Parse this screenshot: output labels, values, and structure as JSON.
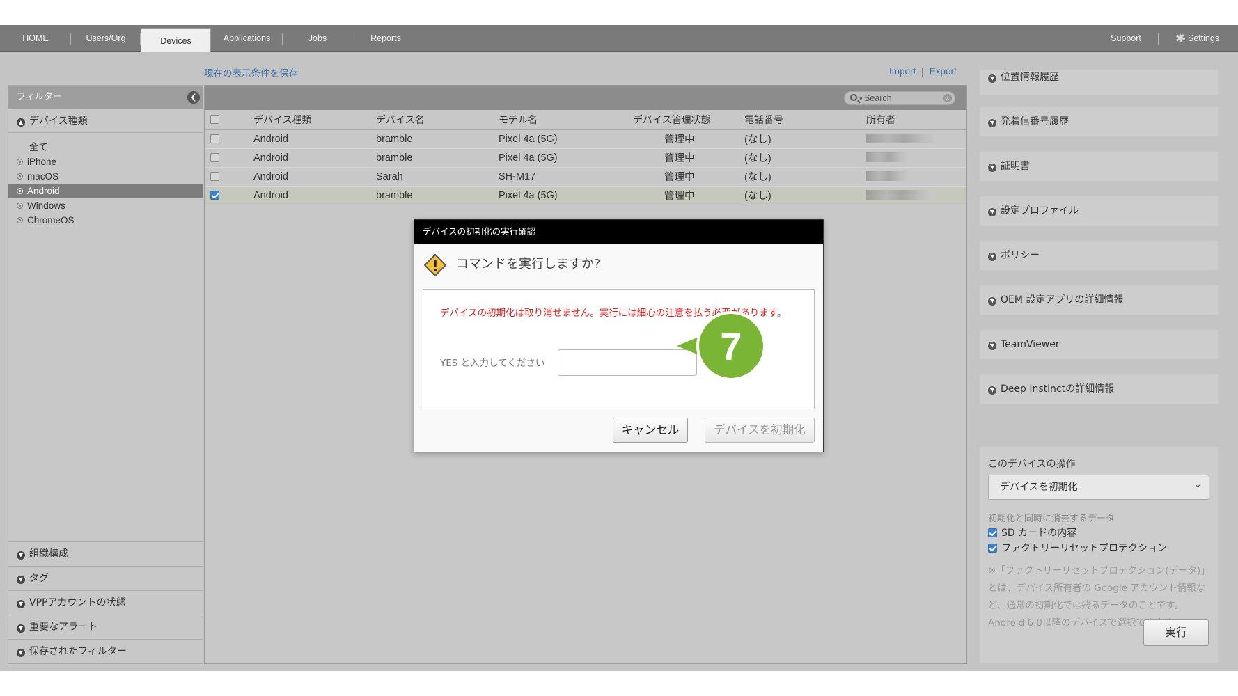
{
  "nav": {
    "home": "HOME",
    "users": "Users/Org",
    "devices": "Devices",
    "applications": "Applications",
    "jobs": "Jobs",
    "reports": "Reports",
    "support": "Support",
    "settings": "Settings"
  },
  "links": {
    "save_view": "現在の表示条件を保存",
    "import": "Import",
    "separator": "|",
    "export": "Export"
  },
  "sidebar": {
    "filter_title": "フィルター",
    "device_types_title": "デバイス種類",
    "types": [
      "全て",
      "iPhone",
      "macOS",
      "Android",
      "Windows",
      "ChromeOS"
    ],
    "selected_type": "Android",
    "sections": [
      "組織構成",
      "タグ",
      "VPPアカウントの状態",
      "重要なアラート",
      "保存されたフィルター"
    ]
  },
  "search": {
    "placeholder": "Search"
  },
  "table": {
    "headers": [
      "デバイス種類",
      "デバイス名",
      "モデル名",
      "デバイス管理状態",
      "電話番号",
      "所有者"
    ],
    "rows": [
      {
        "type": "Android",
        "name": "bramble",
        "model": "Pixel 4a (5G)",
        "status": "管理中",
        "phone": "(なし)",
        "checked": false
      },
      {
        "type": "Android",
        "name": "bramble",
        "model": "Pixel 4a (5G)",
        "status": "管理中",
        "phone": "(なし)",
        "checked": false
      },
      {
        "type": "Android",
        "name": "Sarah",
        "model": "SH-M17",
        "status": "管理中",
        "phone": "(なし)",
        "checked": false
      },
      {
        "type": "Android",
        "name": "bramble",
        "model": "Pixel 4a (5G)",
        "status": "管理中",
        "phone": "(なし)",
        "checked": true
      }
    ]
  },
  "modal": {
    "title": "デバイスの初期化の実行確認",
    "question": "コマンドを実行しますか?",
    "warning": "デバイスの初期化は取り消せません。実行には細心の注意を払う必要があります。",
    "input_label": "YES と入力してください",
    "input_value": "",
    "cancel": "キャンセル",
    "confirm": "デバイスを初期化"
  },
  "callout": {
    "number": "7",
    "color": "#7ab536"
  },
  "right_panel": {
    "items": [
      "位置情報履歴",
      "発着信番号履歴",
      "証明書",
      "設定プロファイル",
      "ポリシー",
      "OEM 設定アプリの詳細情報",
      "TeamViewer",
      "Deep Instinctの詳細情報"
    ],
    "ops_title": "このデバイスの操作",
    "ops_selected": "デバイスを初期化",
    "erase_label": "初期化と同時に消去するデータ",
    "erase_options": [
      {
        "label": "SD カードの内容",
        "checked": true
      },
      {
        "label": "ファクトリーリセットプロテクション",
        "checked": true
      }
    ],
    "note": "※「ファクトリーリセットプロテクション(データ)」とは、デバイス所有者の Google アカウント情報など、通常の初期化では残るデータのことです。Android 6.0以降のデバイスで選択できます。",
    "run": "実行"
  }
}
